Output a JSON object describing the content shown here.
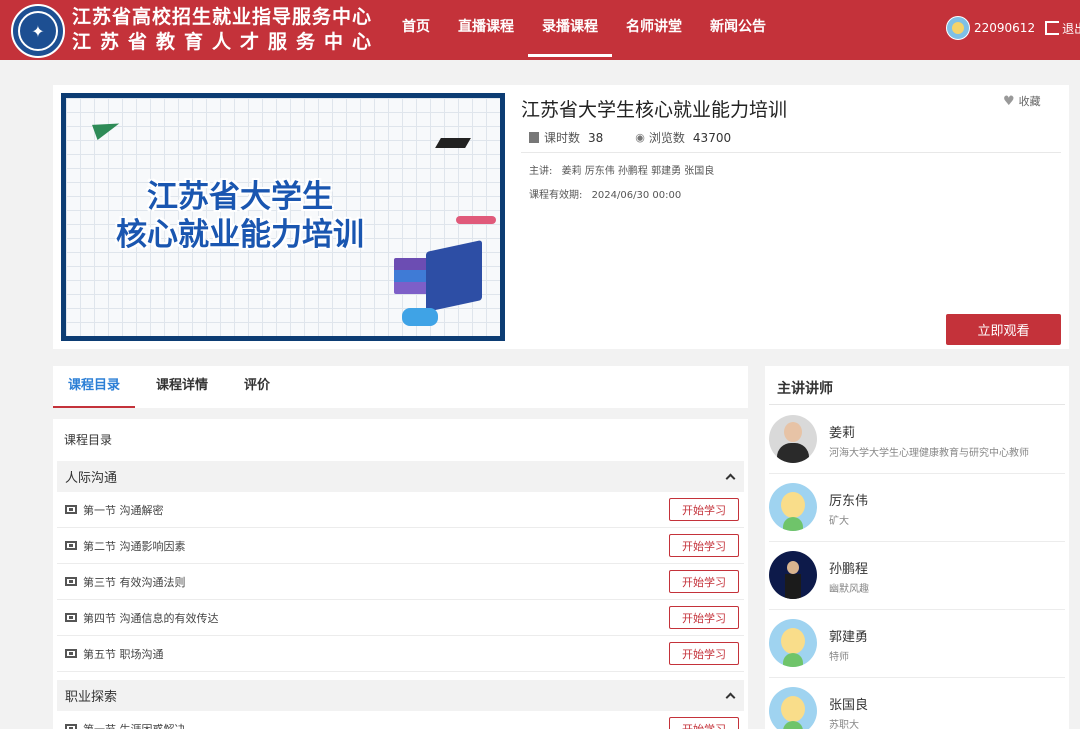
{
  "header": {
    "brand_line1": "江苏省高校招生就业指导服务中心",
    "brand_line2": "江苏省教育人才服务中心",
    "nav": [
      "首页",
      "直播课程",
      "录播课程",
      "名师讲堂",
      "新闻公告"
    ],
    "active_nav_index": 2,
    "username": "22090612",
    "logout_label": "退出系"
  },
  "course": {
    "cover_title_line1": "江苏省大学生",
    "cover_title_line2": "核心就业能力培训",
    "title": "江苏省大学生核心就业能力培训",
    "favorite_label": "收藏",
    "lessons_label": "课时数",
    "lessons_count": "38",
    "views_label": "浏览数",
    "views_count": "43700",
    "lecturers_label": "主讲:",
    "lecturers": "姜莉 厉东伟 孙鹏程 郭建勇 张国良",
    "validity_label": "课程有效期:",
    "validity": "2024/06/30 00:00",
    "watch_button": "立即观看"
  },
  "tabs": [
    "课程目录",
    "课程详情",
    "评价"
  ],
  "catalog": {
    "heading": "课程目录",
    "sections": [
      {
        "title": "人际沟通",
        "lessons": [
          "第一节 沟通解密",
          "第二节 沟通影响因素",
          "第三节 有效沟通法则",
          "第四节 沟通信息的有效传达",
          "第五节 职场沟通"
        ]
      },
      {
        "title": "职业探索",
        "lessons": [
          "第一节 生涯困惑解决"
        ]
      }
    ],
    "start_label": "开始学习"
  },
  "teachers": {
    "heading": "主讲讲师",
    "list": [
      {
        "name": "姜莉",
        "desc": "河海大学大学生心理健康教育与研究中心教师"
      },
      {
        "name": "厉东伟",
        "desc": "矿大"
      },
      {
        "name": "孙鹏程",
        "desc": "幽默风趣"
      },
      {
        "name": "郭建勇",
        "desc": "特师"
      },
      {
        "name": "张国良",
        "desc": "苏职大"
      }
    ]
  },
  "colors": {
    "brand_red": "#c4323a",
    "tab_active_blue": "#2c7fd6"
  }
}
